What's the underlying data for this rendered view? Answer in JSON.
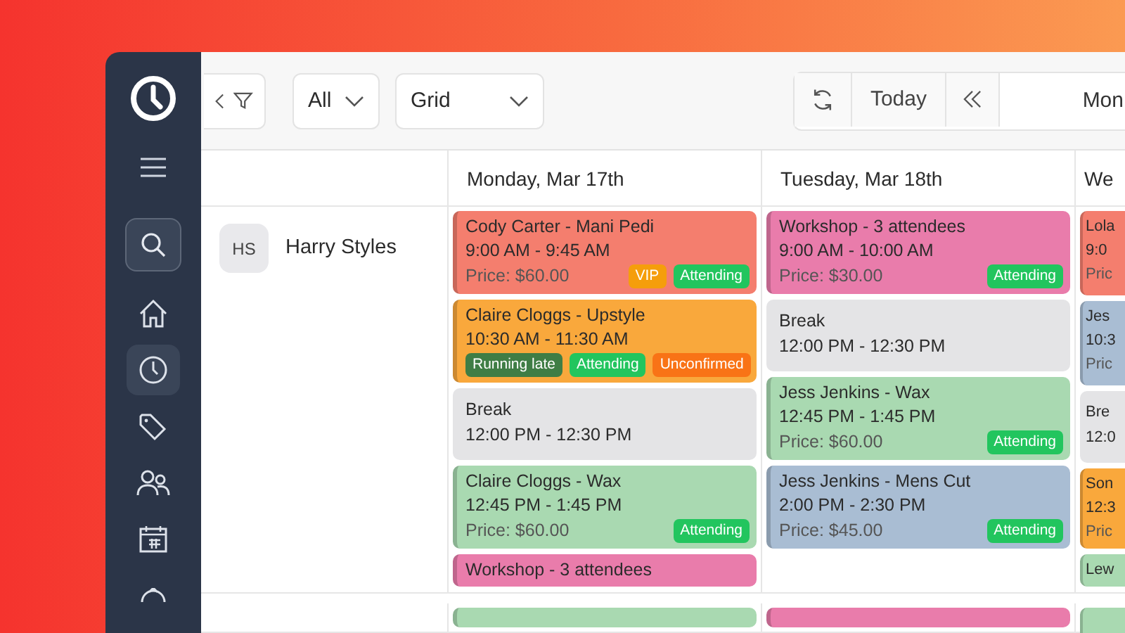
{
  "sidebar": {
    "items": [
      {
        "kind": "menu",
        "selected": false
      },
      {
        "kind": "search",
        "selected": true
      },
      {
        "kind": "home",
        "selected": false
      },
      {
        "kind": "clock",
        "selected": true
      },
      {
        "kind": "tag",
        "selected": false
      },
      {
        "kind": "people",
        "selected": false
      },
      {
        "kind": "calendar",
        "selected": false
      },
      {
        "kind": "gear",
        "selected": false
      }
    ]
  },
  "toolbar": {
    "filter_select": {
      "value": "All"
    },
    "view_select": {
      "value": "Grid"
    },
    "today_button": "Today",
    "date_field": {
      "value": "Mon"
    }
  },
  "columns": [
    {
      "label": "Monday, Mar 17th"
    },
    {
      "label": "Tuesday, Mar 18th"
    },
    {
      "label": "We"
    }
  ],
  "staff": [
    {
      "initials": "HS",
      "name": "Harry Styles",
      "days": [
        [
          {
            "kind": "appointment",
            "title": "Cody Carter - Mani Pedi",
            "time": "9:00 AM - 9:45 AM",
            "price": "Price: $60.00",
            "color": "#f47e6e",
            "tags": [
              {
                "label": "VIP",
                "color": "#f59e0b"
              },
              {
                "label": "Attending",
                "color": "#22c55e"
              }
            ]
          },
          {
            "kind": "appointment",
            "title": "Claire Cloggs - Upstyle",
            "time": "10:30 AM - 11:30 AM",
            "color": "#f9a83c",
            "tags": [
              {
                "label": "Running late",
                "color": "#3f7d45"
              },
              {
                "label": "Attending",
                "color": "#22c55e"
              },
              {
                "label": "Unconfirmed",
                "color": "#f97316"
              }
            ]
          },
          {
            "kind": "break",
            "title": "Break",
            "time": "12:00 PM - 12:30 PM",
            "color": "#e4e4e6"
          },
          {
            "kind": "appointment",
            "title": "Claire Cloggs - Wax",
            "time": "12:45 PM - 1:45 PM",
            "price": "Price: $60.00",
            "color": "#a9d9b1",
            "tags": [
              {
                "label": "Attending",
                "color": "#22c55e"
              }
            ]
          },
          {
            "kind": "appointment",
            "title": "Workshop - 3 attendees",
            "color": "#e97cab"
          }
        ],
        [
          {
            "kind": "appointment",
            "title": "Workshop - 3 attendees",
            "time": "9:00 AM - 10:00 AM",
            "price": "Price: $30.00",
            "color": "#e97cab",
            "tags": [
              {
                "label": "Attending",
                "color": "#22c55e"
              }
            ]
          },
          {
            "kind": "break",
            "title": "Break",
            "time": "12:00 PM - 12:30 PM",
            "color": "#e4e4e6"
          },
          {
            "kind": "appointment",
            "title": "Jess Jenkins - Wax",
            "time": "12:45 PM - 1:45 PM",
            "price": "Price: $60.00",
            "color": "#a9d9b1",
            "tags": [
              {
                "label": "Attending",
                "color": "#22c55e"
              }
            ]
          },
          {
            "kind": "appointment",
            "title": "Jess Jenkins - Mens Cut",
            "time": "2:00 PM - 2:30 PM",
            "price": "Price: $45.00",
            "color": "#a9bdd3",
            "tags": [
              {
                "label": "Attending",
                "color": "#22c55e"
              }
            ]
          }
        ],
        [
          {
            "kind": "appointment",
            "title": "Lola",
            "time": "9:0",
            "price": "Pric",
            "color": "#f47e6e"
          },
          {
            "kind": "appointment",
            "title": "Jes",
            "time": "10:3",
            "price": "Pric",
            "color": "#a9bdd3"
          },
          {
            "kind": "break",
            "title": "Bre",
            "time": "12:0",
            "color": "#e4e4e6"
          },
          {
            "kind": "appointment",
            "title": "Son",
            "time": "12:3",
            "price": "Pric",
            "color": "#f9a83c"
          },
          {
            "kind": "appointment",
            "title": "Lew",
            "color": "#a9d9b1"
          }
        ]
      ]
    },
    {
      "days": [
        [
          {
            "kind": "appointment",
            "color": "#a9d9b1"
          }
        ],
        [
          {
            "kind": "appointment",
            "color": "#e97cab"
          }
        ],
        [
          {
            "kind": "appointment",
            "color": "#a9d9b1"
          }
        ]
      ]
    }
  ]
}
